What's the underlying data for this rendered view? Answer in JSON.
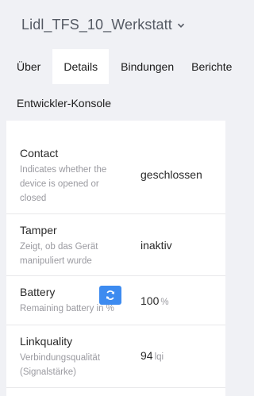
{
  "header": {
    "title": "Lidl_TFS_10_Werkstatt",
    "dropdown_icon": "chevron-down-icon"
  },
  "tabs": [
    {
      "label": "Über"
    },
    {
      "label": "Details",
      "active": true
    },
    {
      "label": "Bindungen"
    },
    {
      "label": "Berichte"
    },
    {
      "label": "Entwickler-Konsole"
    }
  ],
  "exposes": [
    {
      "name": "Contact",
      "description": "Indicates whether the device is opened or closed",
      "value": "geschlossen",
      "unit": ""
    },
    {
      "name": "Tamper",
      "description": "Zeigt, ob das Gerät manipuliert wurde",
      "value": "inaktiv",
      "unit": ""
    },
    {
      "name": "Battery",
      "description": "Remaining battery in %",
      "value": "100",
      "unit": "%",
      "refresh_icon": "refresh-icon"
    },
    {
      "name": "Linkquality",
      "description": "Verbindungsqualität (Signalstärke)",
      "value": "94",
      "unit": "lqi"
    }
  ],
  "colors": {
    "accent": "#3d8bf0",
    "background": "#f0f1f5",
    "card": "#ffffff"
  }
}
